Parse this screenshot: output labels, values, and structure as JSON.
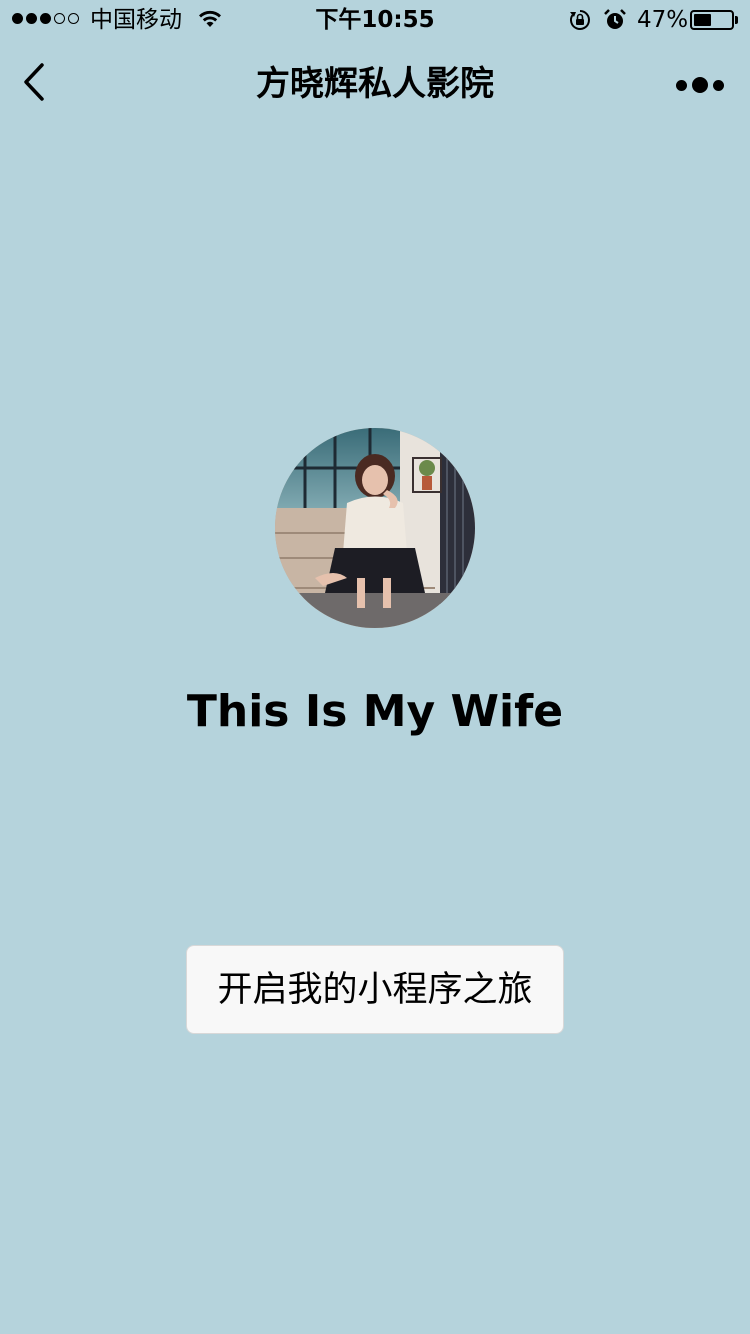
{
  "status_bar": {
    "signal_filled": 3,
    "signal_total": 5,
    "carrier": "中国移动",
    "time": "下午10:55",
    "battery_percent_text": "47%",
    "battery_level": 0.47
  },
  "nav": {
    "title": "方晓辉私人影院",
    "back_icon": "chevron-left-icon",
    "more_icon": "more-dots-icon"
  },
  "profile": {
    "avatar_alt": "avatar photo",
    "headline": "This Is My Wife"
  },
  "actions": {
    "start_label": "开启我的小程序之旅"
  },
  "colors": {
    "background": "#b5d3dc",
    "button_bg": "#f8f8f8"
  }
}
